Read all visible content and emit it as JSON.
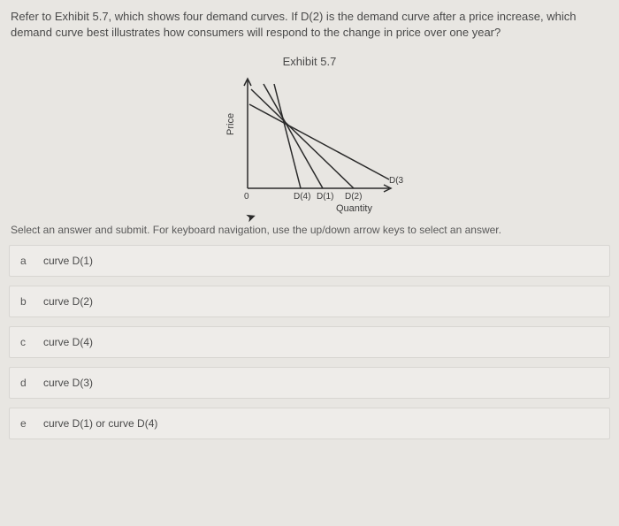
{
  "question_text": "Refer to Exhibit 5.7, which shows four demand curves. If D(2) is the demand curve after a price increase, which demand curve best illustrates how consumers will respond to the change in price over one year?",
  "exhibit": {
    "title": "Exhibit 5.7",
    "y_label": "Price",
    "x_label": "Quantity",
    "origin_label": "0",
    "curve_labels": {
      "d1": "D(1)",
      "d2": "D(2)",
      "d3": "D(3",
      "d4": "D(4)"
    }
  },
  "instruction": "Select an answer and submit. For keyboard navigation, use the up/down arrow keys to select an answer.",
  "answers": [
    {
      "key": "a",
      "label": "curve D(1)"
    },
    {
      "key": "b",
      "label": "curve D(2)"
    },
    {
      "key": "c",
      "label": "curve D(4)"
    },
    {
      "key": "d",
      "label": "curve D(3)"
    },
    {
      "key": "e",
      "label": "curve D(1) or curve D(4)"
    }
  ],
  "chart_data": {
    "type": "line",
    "title": "Exhibit 5.7",
    "xlabel": "Quantity",
    "ylabel": "Price",
    "series": [
      {
        "name": "D(4)",
        "x": [
          0.2,
          0.4
        ],
        "y": [
          1.0,
          0.0
        ]
      },
      {
        "name": "D(1)",
        "x": [
          0.1,
          0.55
        ],
        "y": [
          1.0,
          0.0
        ]
      },
      {
        "name": "D(2)",
        "x": [
          0.0,
          0.78
        ],
        "y": [
          0.95,
          0.0
        ]
      },
      {
        "name": "D(3)",
        "x": [
          0.0,
          1.0
        ],
        "y": [
          0.82,
          0.1
        ]
      }
    ],
    "xlim": [
      0,
      1
    ],
    "ylim": [
      0,
      1
    ]
  }
}
